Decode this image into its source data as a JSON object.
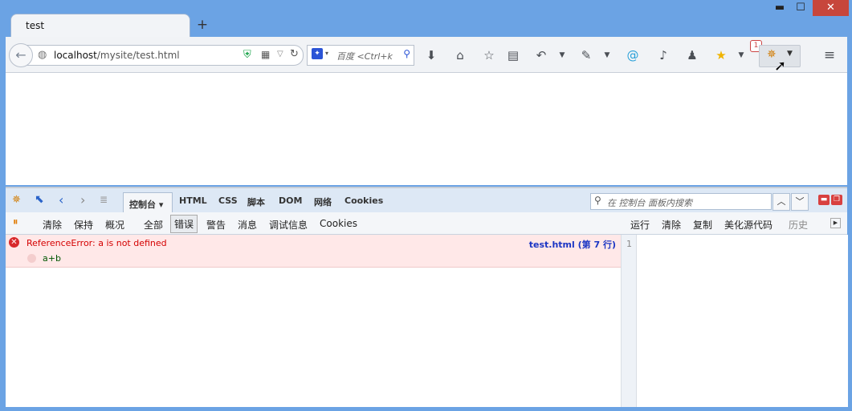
{
  "window": {
    "tab_title": "test",
    "new_tab": "+",
    "min": "▬",
    "max": "☐",
    "close": "✕"
  },
  "nav": {
    "back_icon": "back-arrow-icon",
    "url_host": "localhost",
    "url_path": "/mysite/test.html",
    "search_placeholder": "百度 <Ctrl+k",
    "badge": "1"
  },
  "firebug": {
    "panel_tabs": [
      "控制台 ▾",
      "HTML",
      "CSS",
      "脚本",
      "DOM",
      "网络",
      "Cookies"
    ],
    "search_placeholder": "在 控制台 面板内搜索",
    "left_sub": [
      "清除",
      "保持",
      "概况",
      "全部",
      "错误",
      "警告",
      "消息",
      "调试信息",
      "Cookies"
    ],
    "right_sub": [
      "运行",
      "清除",
      "复制",
      "美化源代码",
      "历史"
    ],
    "error": {
      "message": "ReferenceError: a is not defined",
      "source": "test.html (第 7 行)",
      "expression": "a+b"
    },
    "editor_line": "1"
  }
}
